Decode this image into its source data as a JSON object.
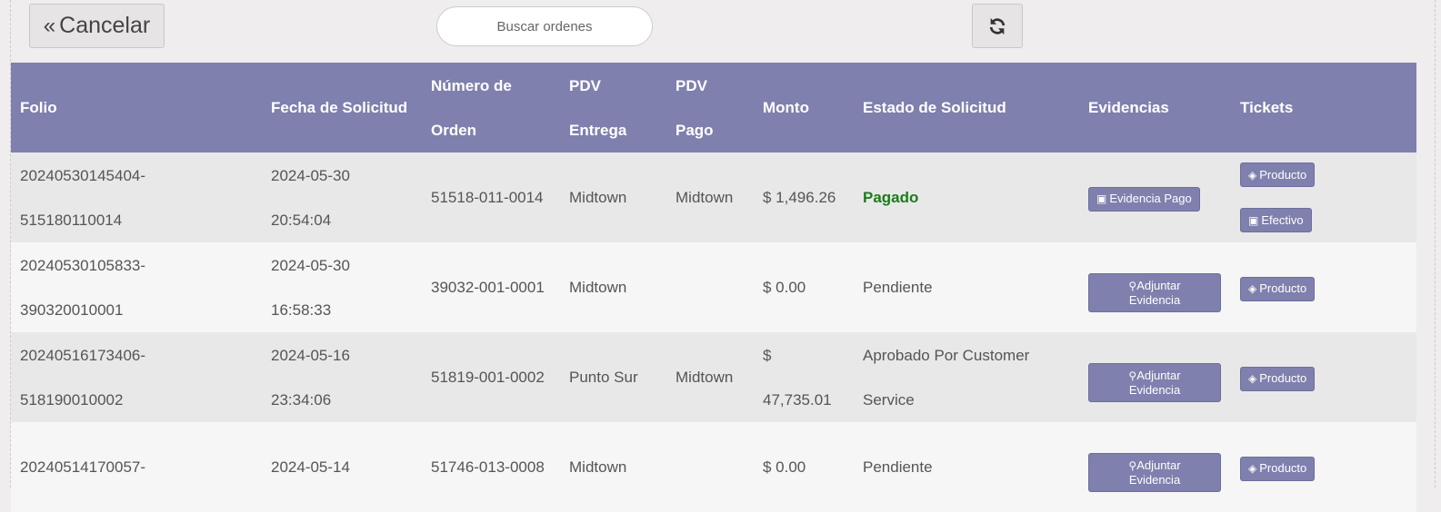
{
  "toolbar": {
    "cancel_label": "Cancelar",
    "cancel_icon": "double-chevron-left-icon",
    "search_placeholder": "Buscar ordenes",
    "refresh_icon": "refresh-icon"
  },
  "table": {
    "headers": {
      "folio": "Folio",
      "fecha": "Fecha de Solicitud",
      "numero_1": "Número de",
      "numero_2": "Orden",
      "pdv_entrega_1": "PDV",
      "pdv_entrega_2": "Entrega",
      "pdv_pago_1": "PDV",
      "pdv_pago_2": "Pago",
      "monto": "Monto",
      "estado": "Estado de Solicitud",
      "evidencias": "Evidencias",
      "tickets": "Tickets"
    },
    "rows": [
      {
        "folio_1": "20240530145404-",
        "folio_2": "515180110014",
        "fecha_1": "2024-05-30",
        "fecha_2": "20:54:04",
        "numero": "51518-011-0014",
        "pdv_entrega": "Midtown",
        "pdv_pago": "Midtown",
        "monto_1": "$ 1,496.26",
        "monto_2": "",
        "estado_1": "Pagado",
        "estado_2": "",
        "evidencia_1": "Evidencia Pago",
        "evidencia_2": "",
        "ticket_1": "Producto",
        "ticket_2": "Efectivo"
      },
      {
        "folio_1": "20240530105833-",
        "folio_2": "390320010001",
        "fecha_1": "2024-05-30",
        "fecha_2": "16:58:33",
        "numero": "39032-001-0001",
        "pdv_entrega": "Midtown",
        "pdv_pago": "",
        "monto_1": "$ 0.00",
        "monto_2": "",
        "estado_1": "Pendiente",
        "estado_2": "",
        "evidencia_1": "Adjuntar",
        "evidencia_2": "Evidencia",
        "ticket_1": "Producto",
        "ticket_2": ""
      },
      {
        "folio_1": "20240516173406-",
        "folio_2": "518190010002",
        "fecha_1": "2024-05-16",
        "fecha_2": "23:34:06",
        "numero": "51819-001-0002",
        "pdv_entrega": "Punto Sur",
        "pdv_pago": "Midtown",
        "monto_1": "$",
        "monto_2": "47,735.01",
        "estado_1": "Aprobado Por Customer",
        "estado_2": "Service",
        "evidencia_1": "Adjuntar",
        "evidencia_2": "Evidencia",
        "ticket_1": "Producto",
        "ticket_2": ""
      },
      {
        "folio_1": "20240514170057-",
        "folio_2": "",
        "fecha_1": "2024-05-14",
        "fecha_2": "",
        "numero": "51746-013-0008",
        "pdv_entrega": "Midtown",
        "pdv_pago": "",
        "monto_1": "$ 0.00",
        "monto_2": "",
        "estado_1": "Pendiente",
        "estado_2": "",
        "evidencia_1": "Adjuntar",
        "evidencia_2": "Evidencia",
        "ticket_1": "Producto",
        "ticket_2": ""
      }
    ]
  },
  "colors": {
    "header_bg": "#7f80ae",
    "paid_status": "#1a7d1a"
  }
}
